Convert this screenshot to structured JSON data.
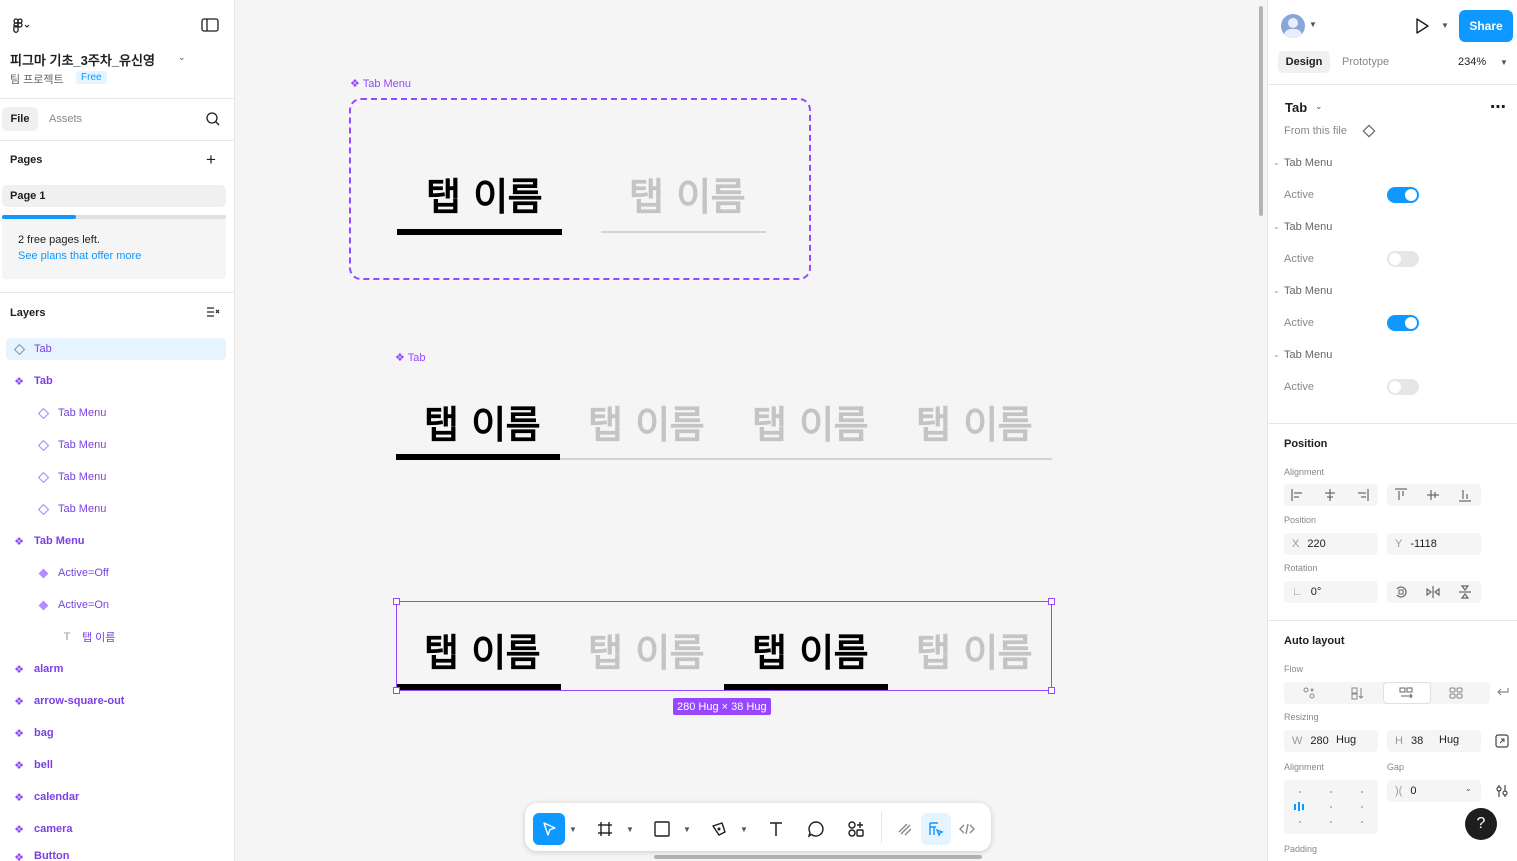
{
  "file": {
    "title": "피그마 기초_3주차_유신영",
    "subtitle": "팀 프로젝트",
    "plan": "Free"
  },
  "leftTabs": {
    "file": "File",
    "assets": "Assets"
  },
  "pages": {
    "header": "Pages",
    "current": "Page 1",
    "notice_line1": "2 free pages left.",
    "notice_link": "See plans that offer more"
  },
  "layers": {
    "header": "Layers",
    "items": [
      {
        "label": "Tab"
      },
      {
        "label": "Tab"
      },
      {
        "label": "Tab Menu"
      },
      {
        "label": "Tab Menu"
      },
      {
        "label": "Tab Menu"
      },
      {
        "label": "Tab Menu"
      },
      {
        "label": "Tab Menu"
      },
      {
        "label": "Active=Off"
      },
      {
        "label": "Active=On"
      },
      {
        "label": "탭 이름"
      },
      {
        "label": "alarm"
      },
      {
        "label": "arrow-square-out"
      },
      {
        "label": "bag"
      },
      {
        "label": "bell"
      },
      {
        "label": "calendar"
      },
      {
        "label": "camera"
      },
      {
        "label": "Button"
      }
    ]
  },
  "canvas": {
    "frame1_label": "Tab Menu",
    "frame2_label": "Tab",
    "tab_text": "탭 이름",
    "size_badge": "280 Hug × 38 Hug"
  },
  "right": {
    "share": "Share",
    "tabs": {
      "design": "Design",
      "prototype": "Prototype",
      "zoom": "234%"
    },
    "component": {
      "name": "Tab",
      "from": "From this file"
    },
    "props": [
      {
        "name": "Tab Menu",
        "prop": "Active",
        "on": true
      },
      {
        "name": "Tab Menu",
        "prop": "Active",
        "on": false
      },
      {
        "name": "Tab Menu",
        "prop": "Active",
        "on": true
      },
      {
        "name": "Tab Menu",
        "prop": "Active",
        "on": false
      }
    ],
    "position": {
      "header": "Position",
      "alignment": "Alignment",
      "position": "Position",
      "x_label": "X",
      "x": "220",
      "y_label": "Y",
      "y": "-1118",
      "rotation": "Rotation",
      "rot": "0°"
    },
    "autolayout": {
      "header": "Auto layout",
      "flow": "Flow",
      "resizing": "Resizing",
      "w_label": "W",
      "w": "280",
      "w_mode": "Hug",
      "h_label": "H",
      "h": "38",
      "h_mode": "Hug",
      "alignment": "Alignment",
      "gap": "Gap",
      "gap_val": "0",
      "padding": "Padding"
    }
  },
  "colors": {
    "accent": "#0d99ff",
    "component": "#9747ff",
    "text_inactive": "#c4c4c4"
  }
}
